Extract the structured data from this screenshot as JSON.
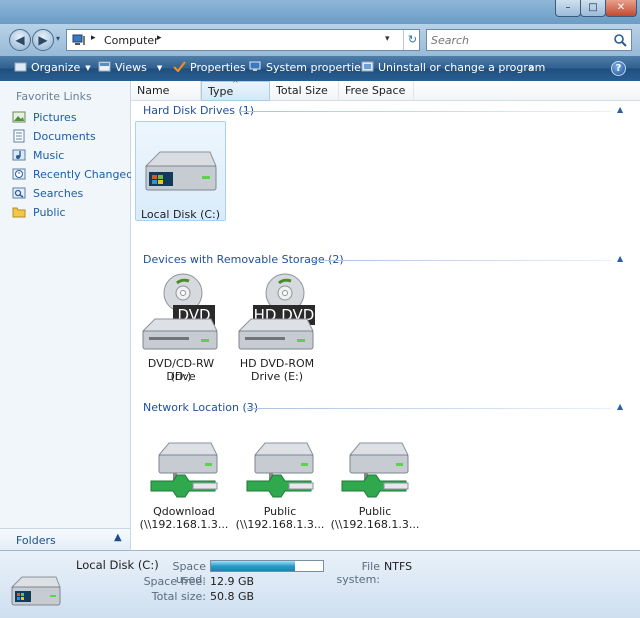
{
  "window": {
    "minimize": "–",
    "maximize": "□",
    "close": "✕"
  },
  "address": {
    "path_root_arrow": "▸",
    "crumb": "Computer",
    "crumb_arrow": "▸",
    "search_placeholder": "Search"
  },
  "toolbar": {
    "organize": "Organize",
    "views": "Views",
    "properties": "Properties",
    "system_properties": "System properties",
    "uninstall": "Uninstall or change a program",
    "more": "»",
    "help": "?"
  },
  "sidebar": {
    "title": "Favorite Links",
    "items": [
      {
        "label": "Pictures",
        "icon": "pictures-icon"
      },
      {
        "label": "Documents",
        "icon": "documents-icon"
      },
      {
        "label": "Music",
        "icon": "music-icon"
      },
      {
        "label": "Recently Changed",
        "icon": "recent-icon"
      },
      {
        "label": "Searches",
        "icon": "searches-icon"
      },
      {
        "label": "Public",
        "icon": "public-folder-icon"
      }
    ],
    "folders_label": "Folders"
  },
  "columns": {
    "name": "Name",
    "type": "Type",
    "total_size": "Total Size",
    "free_space": "Free Space"
  },
  "groups": {
    "hdd": {
      "title": "Hard Disk Drives (1)",
      "items": [
        {
          "label": "Local Disk (C:)"
        }
      ]
    },
    "removable": {
      "title": "Devices with Removable Storage (2)",
      "items": [
        {
          "label1": "DVD/CD-RW Drive",
          "label2": "(D:)",
          "badge": "DVD"
        },
        {
          "label1": "HD DVD-ROM",
          "label2": "Drive (E:)",
          "badge": "HD DVD"
        }
      ]
    },
    "network": {
      "title": "Network Location (3)",
      "items": [
        {
          "label1": "Qdownload",
          "label2": "(\\\\192.168.1.3..."
        },
        {
          "label1": "Public",
          "label2": "(\\\\192.168.1.3..."
        },
        {
          "label1": "Public",
          "label2": "(\\\\192.168.1.3..."
        }
      ]
    }
  },
  "details": {
    "title": "Local Disk (C:)",
    "space_used_label": "Space used:",
    "space_used_fraction": 0.746,
    "file_system_label": "File system:",
    "file_system_value": "NTFS",
    "space_free_label": "Space free:",
    "space_free_value": "12.9 GB",
    "total_size_label": "Total size:",
    "total_size_value": "50.8 GB"
  },
  "colors": {
    "accent": "#1f4f98",
    "toolbar": "#2f5f8f"
  }
}
